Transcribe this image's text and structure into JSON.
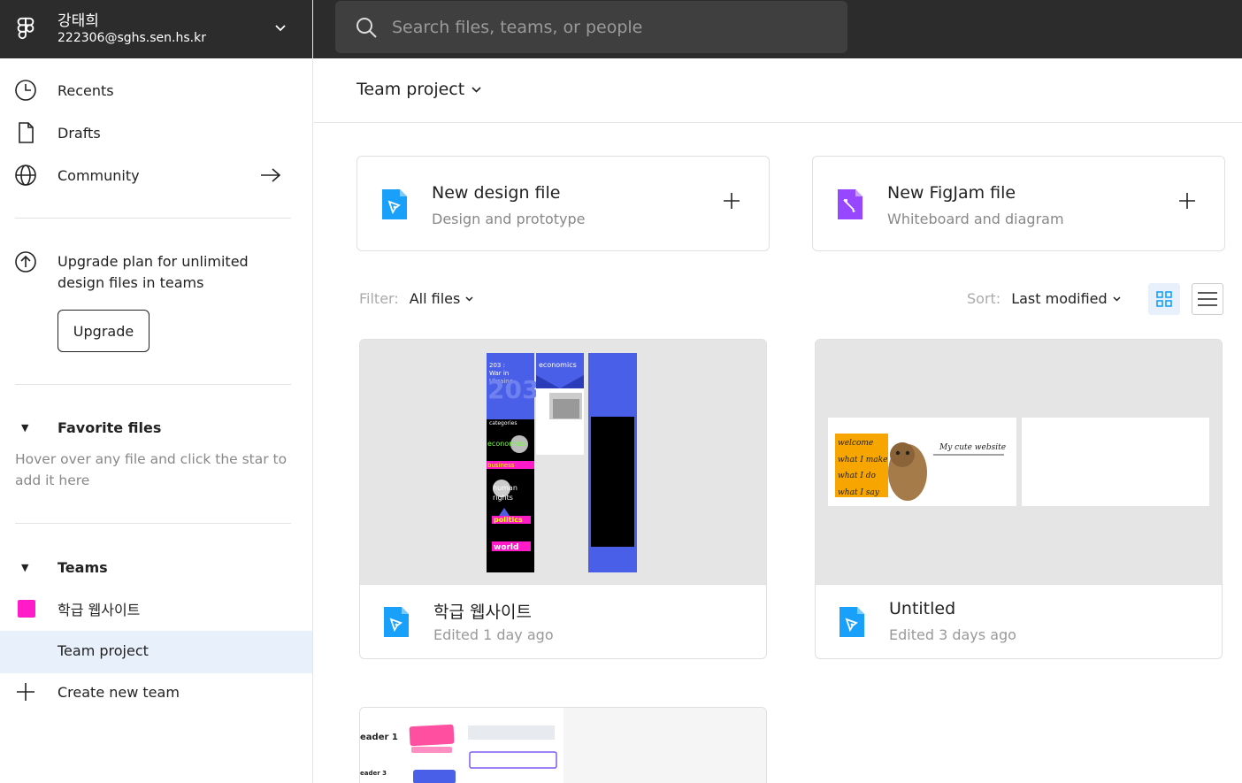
{
  "account": {
    "name": "강태희",
    "email": "222306@sghs.sen.hs.kr"
  },
  "search": {
    "placeholder": "Search files, teams, or people"
  },
  "nav": {
    "recents": "Recents",
    "drafts": "Drafts",
    "community": "Community"
  },
  "upgrade": {
    "text": "Upgrade plan for unlimited design files in teams",
    "button": "Upgrade"
  },
  "favorites": {
    "title": "Favorite files",
    "hint": "Hover over any file and click the star to add it here"
  },
  "teams": {
    "title": "Teams",
    "items": [
      {
        "name": "학급 웹사이트",
        "color": "#ff1bc7"
      }
    ],
    "active_project": "Team project",
    "create": "Create new team"
  },
  "header": {
    "title": "Team project"
  },
  "new_files": [
    {
      "title": "New design file",
      "subtitle": "Design and prototype",
      "icon": "design-file-icon",
      "color": "#18a0fb"
    },
    {
      "title": "New FigJam file",
      "subtitle": "Whiteboard and diagram",
      "icon": "figjam-file-icon",
      "color": "#9747ff"
    }
  ],
  "filter": {
    "label": "Filter:",
    "value": "All files"
  },
  "sort": {
    "label": "Sort:",
    "value": "Last modified"
  },
  "files": [
    {
      "name": "학급 웹사이트",
      "meta": "Edited 1 day ago"
    },
    {
      "name": "Untitled",
      "meta": "Edited 3 days ago"
    },
    {
      "name": "",
      "meta": ""
    }
  ],
  "thumb_text": {
    "a_title": "203 : War in Ukraine",
    "a_big": "203",
    "a_econ": "economics",
    "a_categories": "categories",
    "a_economics": "economics",
    "a_business": "business",
    "a_human": "human rights",
    "a_politics": "politics",
    "a_world": "world",
    "b_welcome": "welcome",
    "b_make": "what I make",
    "b_do": "what I do",
    "b_say": "what I say",
    "b_title": "My cute website",
    "c_header1": "eader 1",
    "c_header3": "eader 3"
  }
}
